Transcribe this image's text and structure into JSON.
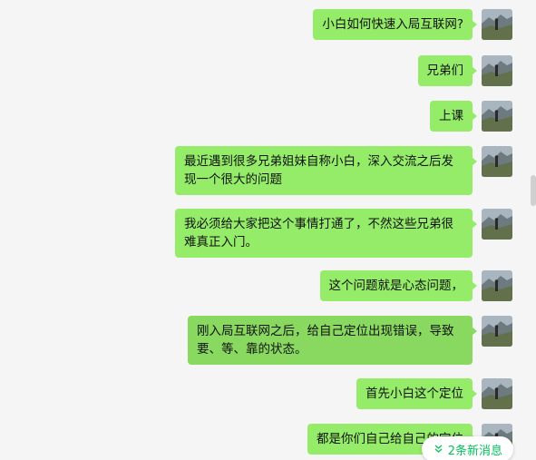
{
  "messages": [
    {
      "text": "小白如何快速入局互联网?"
    },
    {
      "text": "兄弟们"
    },
    {
      "text": "上课"
    },
    {
      "text": "最近遇到很多兄弟姐妹自称小白，深入交流之后发现一个很大的问题"
    },
    {
      "text": "我必须给大家把这个事情打通了，不然这些兄弟很难真正入门。"
    },
    {
      "text": "这个问题就是心态问题，"
    },
    {
      "text": "刚入局互联网之后，给自己定位出现错误，导致要、等、靠的状态。"
    },
    {
      "text": "首先小白这个定位"
    },
    {
      "text": "都是你们自己给自己的定位"
    }
  ],
  "new_messages_badge": {
    "label": "2条新消息",
    "icon": "double-chevron-down-icon"
  },
  "colors": {
    "bubble": "#95ec69",
    "bubble_highlight": "#89d961",
    "background": "#f5f5f5",
    "badge_text": "#07c160"
  }
}
